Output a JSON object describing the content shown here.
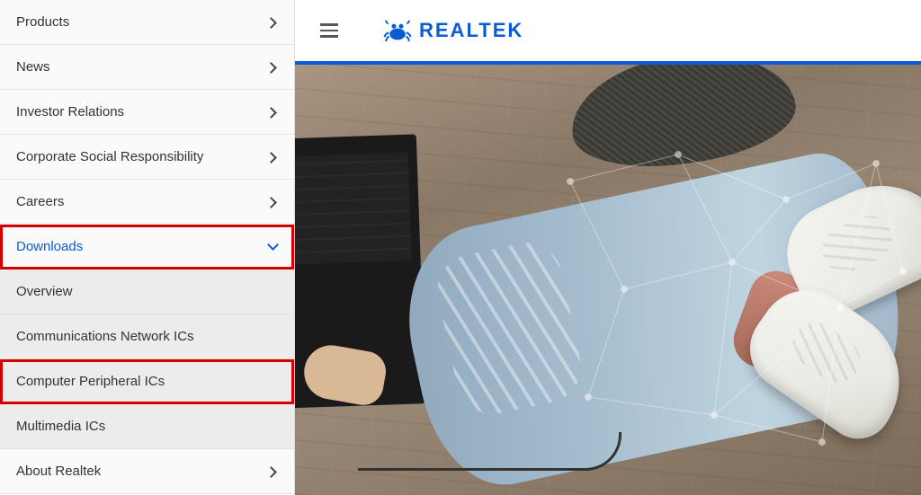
{
  "brand": {
    "name": "REALTEK",
    "color": "#0a5cd6"
  },
  "nav": {
    "items": [
      {
        "label": "Products",
        "expandable": true,
        "expanded": false
      },
      {
        "label": "News",
        "expandable": true,
        "expanded": false
      },
      {
        "label": "Investor Relations",
        "expandable": true,
        "expanded": false
      },
      {
        "label": "Corporate Social Responsibility",
        "expandable": true,
        "expanded": false
      },
      {
        "label": "Careers",
        "expandable": true,
        "expanded": false
      },
      {
        "label": "Downloads",
        "expandable": true,
        "expanded": true,
        "highlighted": true
      },
      {
        "label": "About Realtek",
        "expandable": true,
        "expanded": false
      }
    ],
    "downloadsSubmenu": [
      {
        "label": "Overview"
      },
      {
        "label": "Communications Network ICs"
      },
      {
        "label": "Computer Peripheral ICs",
        "highlighted": true
      },
      {
        "label": "Multimedia ICs"
      }
    ]
  }
}
